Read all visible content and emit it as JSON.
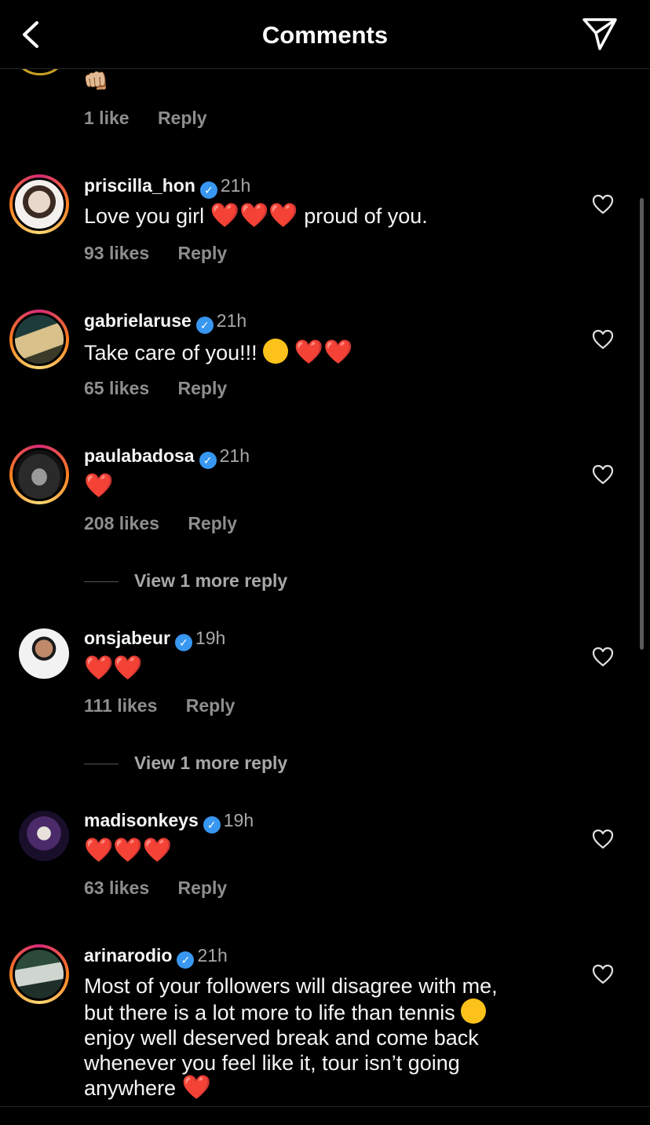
{
  "header": {
    "title": "Comments"
  },
  "top_partial": {
    "likes": "1 like",
    "reply": "Reply",
    "emoji": "👊🏼"
  },
  "comments": [
    {
      "username": "priscilla_hon",
      "time": "21h",
      "text_before": "Love you girl",
      "hearts": "❤️❤️❤️",
      "text_after": "proud of you.",
      "likes": "93 likes",
      "reply": "Reply"
    },
    {
      "username": "gabrielaruse",
      "time": "21h",
      "text_before": "Take care of you!!!",
      "emoji_face": "😘",
      "hearts": "❤️❤️",
      "likes": "65 likes",
      "reply": "Reply"
    },
    {
      "username": "paulabadosa",
      "time": "21h",
      "hearts": "❤️",
      "likes": "208 likes",
      "reply": "Reply",
      "view_replies": "View 1 more reply"
    },
    {
      "username": "onsjabeur",
      "time": "19h",
      "hearts": "❤️❤️",
      "likes": "111 likes",
      "reply": "Reply",
      "view_replies": "View 1 more reply"
    },
    {
      "username": "madisonkeys",
      "time": "19h",
      "hearts": "❤️❤️❤️",
      "likes": "63 likes",
      "reply": "Reply"
    },
    {
      "username": "arinarodio",
      "time": "21h",
      "line1": "Most of your followers will disagree with me,",
      "line2": "but there is a lot more to life than tennis",
      "emoji_sweat": "😅",
      "line3": "enjoy well deserved break and come back",
      "line4": "whenever you feel like it, tour isn’t going",
      "line5": "anywhere",
      "hearts": "❤️"
    }
  ],
  "icons": {
    "back": "chevron-left-icon",
    "send": "paper-plane-icon",
    "like": "heart-outline-icon",
    "verified": "verified-badge-icon"
  },
  "colors": {
    "background": "#000000",
    "verified": "#3897f0",
    "meta": "#8e8e8e",
    "heart": "#ff2b3b"
  }
}
